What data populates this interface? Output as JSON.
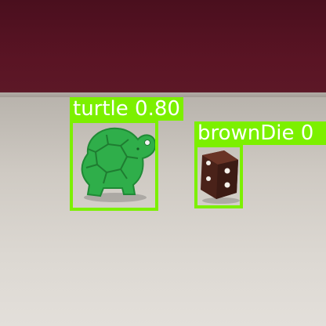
{
  "detections": [
    {
      "class": "turtle",
      "score": "0.80",
      "label": "turtle 0.80"
    },
    {
      "class": "brownDie",
      "score": "0",
      "label": "brownDie 0"
    }
  ],
  "colors": {
    "box": "#7cf000",
    "label_text": "#ffffff",
    "wall": "#5a1424",
    "table": "#d6d2cc",
    "turtle": "#2fae4a",
    "die": "#4a2219"
  },
  "icons": {
    "turtle": "turtle-object",
    "die": "brown-die-object"
  }
}
